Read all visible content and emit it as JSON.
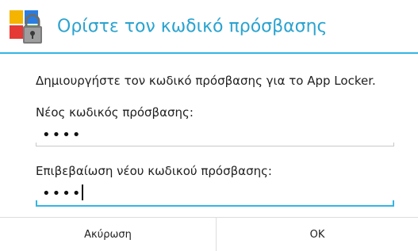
{
  "dialog": {
    "title": "Ορίστε τον κωδικό πρόσβασης",
    "icon": "app-locker-icon",
    "message": "Δημιουργήστε τον κωδικό πρόσβασης για το App Locker."
  },
  "fields": {
    "new_password": {
      "label": "Νέος κωδικός πρόσβασης:",
      "value": "••••"
    },
    "confirm_password": {
      "label": "Επιβεβαίωση νέου κωδικού πρόσβασης:",
      "value": "••••"
    }
  },
  "buttons": {
    "cancel": "Ακύρωση",
    "ok": "OK"
  },
  "colors": {
    "accent": "#33b5e5",
    "title": "#2aa3cf",
    "text": "#1f1f1f"
  }
}
